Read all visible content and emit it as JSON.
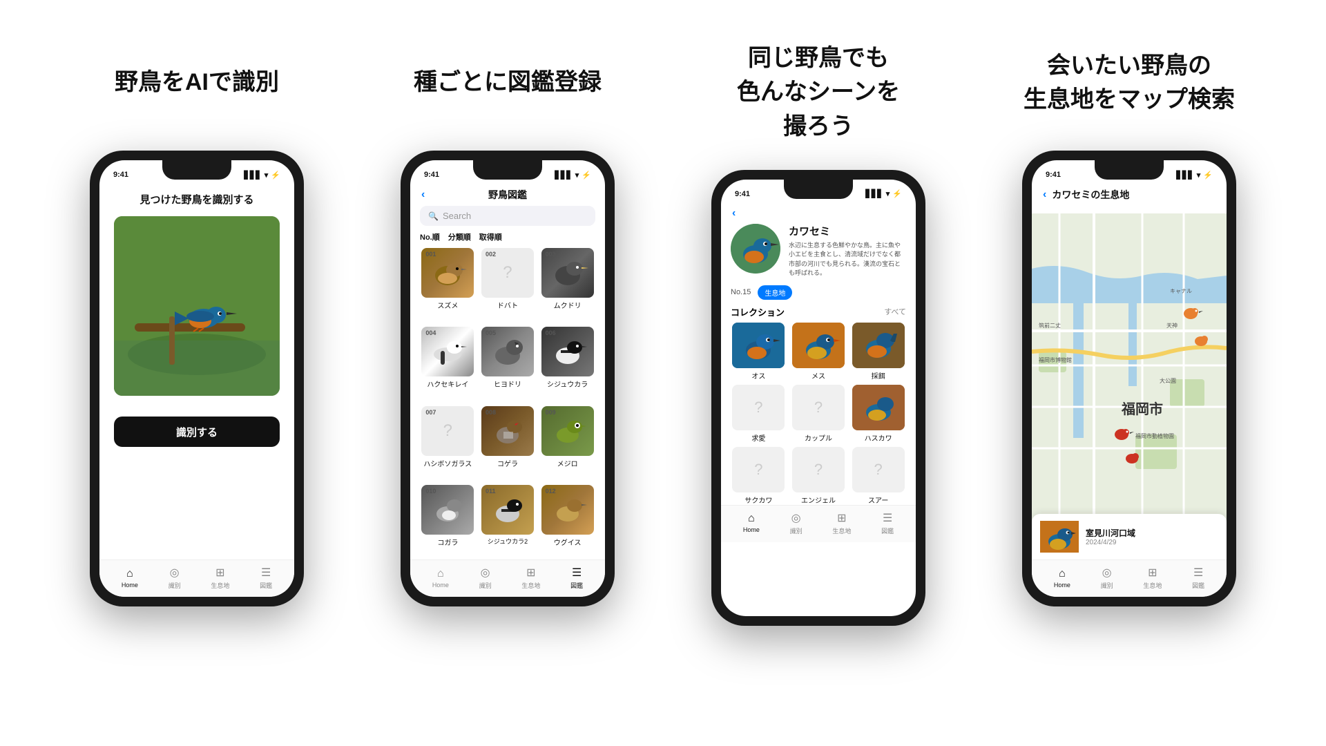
{
  "columns": [
    {
      "id": "col1",
      "title": "野鳥をAIで識別",
      "phone": {
        "time": "9:41",
        "subtitle": "見つけた野鳥を識別する",
        "identify_btn": "識別する",
        "nav": [
          {
            "label": "Home",
            "icon": "⌂",
            "active": true
          },
          {
            "label": "識別",
            "icon": "◎",
            "active": false
          },
          {
            "label": "生息地",
            "icon": "⊞",
            "active": false
          },
          {
            "label": "図鑑",
            "icon": "≡",
            "active": false
          }
        ]
      }
    },
    {
      "id": "col2",
      "title": "種ごとに図鑑登録",
      "phone": {
        "time": "9:41",
        "header": "野鳥図鑑",
        "search_placeholder": "Search",
        "tabs": [
          "No.順",
          "分類順",
          "取得順"
        ],
        "birds": [
          {
            "num": "001",
            "name": "スズメ",
            "type": "sparrow",
            "known": true
          },
          {
            "num": "002",
            "name": "ドバト",
            "type": "unknown",
            "known": false
          },
          {
            "num": "003",
            "name": "ムクドリ",
            "type": "starling",
            "known": true
          },
          {
            "num": "004",
            "name": "ハクセキレイ",
            "type": "wagtail",
            "known": true
          },
          {
            "num": "005",
            "name": "ヒヨドリ",
            "type": "bulbul",
            "known": true
          },
          {
            "num": "006",
            "name": "シジュウカラ",
            "type": "tit",
            "known": true
          },
          {
            "num": "007",
            "name": "ハシボソガラス",
            "type": "unknown",
            "known": false
          },
          {
            "num": "008",
            "name": "コゲラ",
            "type": "woodpecker",
            "known": true
          },
          {
            "num": "009",
            "name": "メジロ",
            "type": "white-eye",
            "known": true
          },
          {
            "num": "010",
            "name": "コガラ",
            "type": "tit2",
            "known": true
          },
          {
            "num": "011",
            "name": "シジュウカラ2",
            "type": "tit3",
            "known": true
          },
          {
            "num": "012",
            "name": "ウグイス",
            "type": "sparrow",
            "known": true
          }
        ],
        "nav": [
          {
            "label": "Home",
            "icon": "⌂",
            "active": false
          },
          {
            "label": "識別",
            "icon": "◎",
            "active": false
          },
          {
            "label": "生息地",
            "icon": "⊞",
            "active": false
          },
          {
            "label": "図鑑",
            "icon": "≡",
            "active": true
          }
        ]
      }
    },
    {
      "id": "col3",
      "title": "同じ野鳥でも\n色んなシーンを\n撮ろう",
      "phone": {
        "time": "9:41",
        "species": "カワセミ",
        "description": "水辺に生息する色鮮やかな鳥。主に魚や小エビを主食とし、清流域だけでなく都市部の河川でも見られる。漢流の宝石とも呼ばれる。",
        "number": "No.15",
        "badge": "生息地",
        "collection_title": "コレクション",
        "collection_all": "すべて",
        "collections": [
          {
            "label": "オス",
            "type": "kingfisher-blue",
            "known": true
          },
          {
            "label": "メス",
            "type": "kingfisher-orange",
            "known": true
          },
          {
            "label": "採餌",
            "type": "kingfisher-brown",
            "known": true
          },
          {
            "label": "求愛",
            "type": "unknown",
            "known": false
          },
          {
            "label": "カップル",
            "type": "unknown",
            "known": false
          },
          {
            "label": "ハスカワ",
            "type": "kingfisher-orange",
            "known": true
          },
          {
            "label": "サクカワ",
            "type": "unknown",
            "known": false
          },
          {
            "label": "エンジェル",
            "type": "unknown",
            "known": false
          },
          {
            "label": "スアー",
            "type": "unknown",
            "known": false
          }
        ],
        "nav": [
          {
            "label": "Home",
            "icon": "⌂",
            "active": true
          },
          {
            "label": "識別",
            "icon": "◎",
            "active": false
          },
          {
            "label": "生息地",
            "icon": "⊞",
            "active": false
          },
          {
            "label": "図鑑",
            "icon": "≡",
            "active": false
          }
        ]
      }
    },
    {
      "id": "col4",
      "title": "会いたい野鳥の\n生息地をマップ検索",
      "phone": {
        "time": "9:41",
        "header": "カワセミの生息地",
        "city": "福岡市",
        "location_card": {
          "title": "室見川河口域",
          "date": "2024/4/29"
        },
        "nav": [
          {
            "label": "Home",
            "icon": "⌂",
            "active": true
          },
          {
            "label": "識別",
            "icon": "◎",
            "active": false
          },
          {
            "label": "生息地",
            "icon": "⊞",
            "active": false
          },
          {
            "label": "図鑑",
            "icon": "≡",
            "active": false
          }
        ]
      }
    }
  ]
}
